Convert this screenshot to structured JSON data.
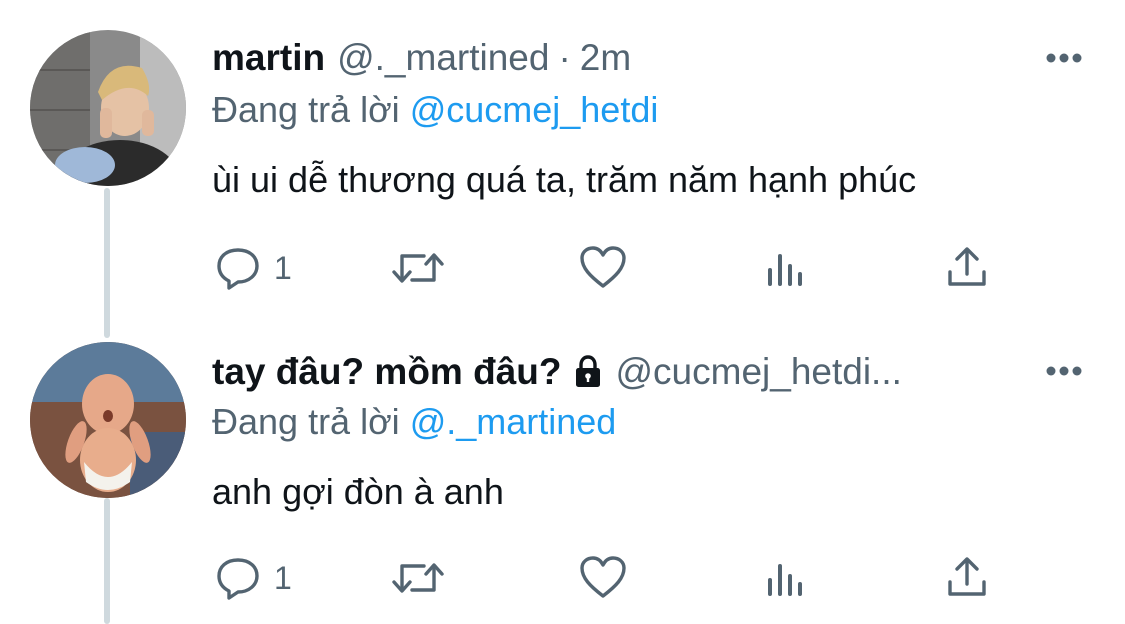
{
  "tweets": [
    {
      "display_name": "martin",
      "handle": "@._martined",
      "separator": "·",
      "time": "2m",
      "reply_prefix": "Đang trả lời",
      "reply_to": "@cucmej_hetdi",
      "text": "ùi ui dễ thương quá ta, trăm năm hạnh phúc",
      "protected": false,
      "reply_count": "1",
      "avatar_icon": "user-photo-avatar"
    },
    {
      "display_name": "tay đâu? mồm đâu?",
      "handle": "@cucmej_hetdi...",
      "reply_prefix": "Đang trả lời",
      "reply_to": "@._martined",
      "text": "anh gợi đòn à anh",
      "protected": true,
      "reply_count": "1",
      "avatar_icon": "baby-photo-avatar"
    }
  ],
  "actions": [
    "reply-icon",
    "retweet-icon",
    "like-icon",
    "analytics-icon",
    "share-icon"
  ],
  "colors": {
    "text": "#0f1419",
    "secondary": "#536471",
    "link": "#1d9bf0",
    "thread_line": "#cfd9de"
  }
}
